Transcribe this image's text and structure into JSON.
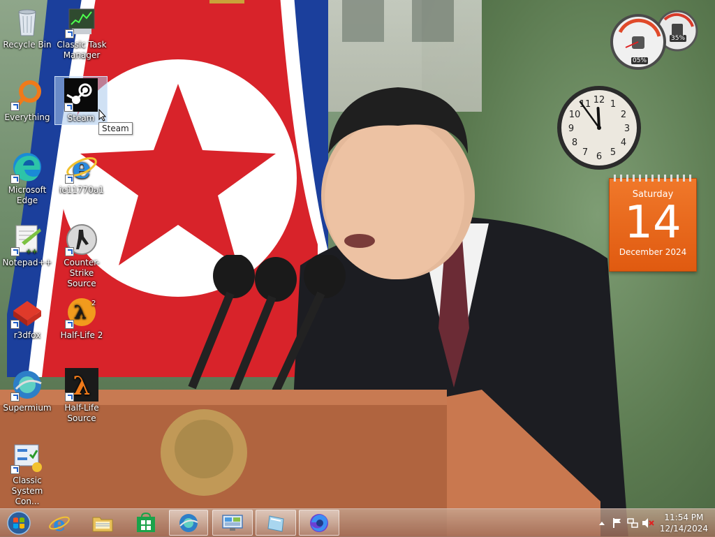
{
  "desktop": {
    "icons": [
      {
        "label": "Recycle Bin",
        "icon": "recycle-bin-icon"
      },
      {
        "label": "Classic Task Manager",
        "icon": "task-manager-icon"
      },
      {
        "label": "Everything",
        "icon": "everything-search-icon"
      },
      {
        "label": "Steam",
        "icon": "steam-icon"
      },
      {
        "label": "Microsoft Edge",
        "icon": "edge-icon"
      },
      {
        "label": "ie11770a1",
        "icon": "internet-explorer-icon"
      },
      {
        "label": "Notepad++",
        "icon": "notepad-plus-plus-icon"
      },
      {
        "label": "Counter-Strike Source",
        "icon": "counter-strike-icon"
      },
      {
        "label": "r3dfox",
        "icon": "r3dfox-icon"
      },
      {
        "label": "Half-Life 2",
        "icon": "half-life-2-icon"
      },
      {
        "label": "Supermium",
        "icon": "supermium-icon"
      },
      {
        "label": "Half-Life Source",
        "icon": "half-life-source-icon"
      },
      {
        "label": "Classic System Con...",
        "icon": "control-panel-icon"
      }
    ],
    "tooltip": "Steam"
  },
  "gadgets": {
    "cpu_meter": {
      "cpu": "05%",
      "ram": "35%"
    },
    "clock": {
      "hour": 11,
      "minute": 54
    },
    "calendar": {
      "day_name": "Saturday",
      "day_number": "14",
      "month_year": "December 2024",
      "color": "#e8661a"
    }
  },
  "taskbar": {
    "buttons": [
      {
        "icon": "start-orb-icon"
      },
      {
        "icon": "internet-explorer-icon"
      },
      {
        "icon": "file-explorer-icon"
      },
      {
        "icon": "store-icon"
      },
      {
        "icon": "supermium-icon"
      },
      {
        "icon": "remote-desktop-icon"
      },
      {
        "icon": "window-app-icon"
      },
      {
        "icon": "firefox-icon"
      }
    ],
    "tray": {
      "icons": [
        "show-hidden-icons-chevron",
        "action-center-flag-icon",
        "network-icon",
        "volume-muted-icon"
      ],
      "time": "11:54 PM",
      "date": "12/14/2024"
    }
  }
}
